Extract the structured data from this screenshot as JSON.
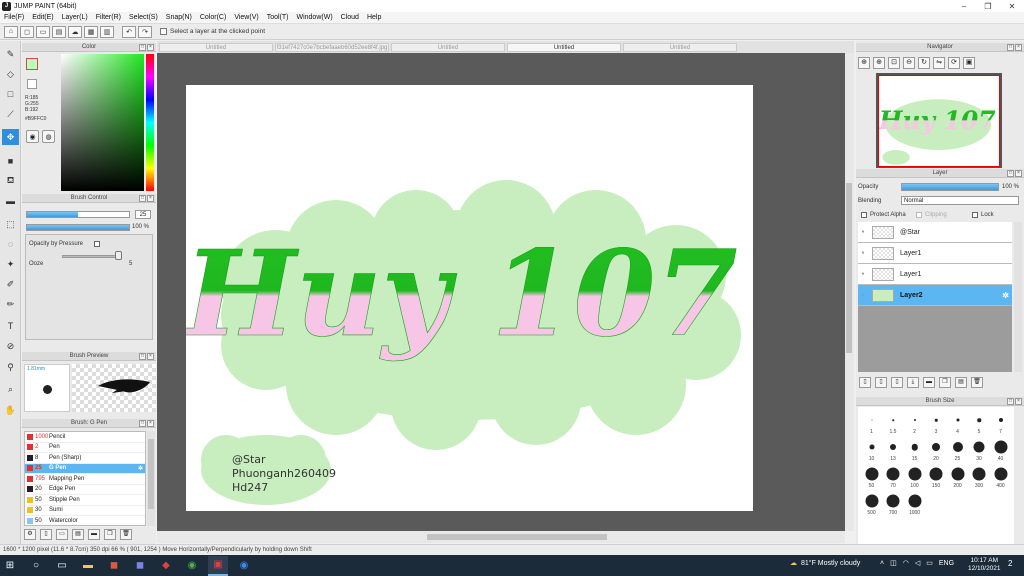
{
  "window": {
    "title": "JUMP PAINT (64bit)",
    "app_icon_glyph": "J",
    "controls": [
      "–",
      "❐",
      "✕"
    ]
  },
  "menu": [
    "File(F)",
    "Edit(E)",
    "Layer(L)",
    "Filter(R)",
    "Select(S)",
    "Snap(N)",
    "Color(C)",
    "View(V)",
    "Tool(T)",
    "Window(W)",
    "Cloud",
    "Help"
  ],
  "toolbar": {
    "hint": "Select a layer at the clicked point"
  },
  "color_panel": {
    "title": "Color",
    "r": "R:185",
    "g": "G:255",
    "b": "B:192",
    "hex": "#B9FFC0",
    "fg_color": "#B9FFC0"
  },
  "brush_control": {
    "title": "Brush Control",
    "size_value": "25",
    "size_fraction": 0.5,
    "opacity_value": "100 %",
    "opacity_fraction": 1.0,
    "opacity_by_pressure": "Opacity by Pressure",
    "ooze_label": "Ooze",
    "ooze_value": "5"
  },
  "brush_preview": {
    "title": "Brush Preview",
    "size": "1.81mm"
  },
  "brush_list": {
    "title": "Brush: G Pen",
    "items": [
      {
        "size": "1000",
        "name": "Pencil",
        "color": "#e03030",
        "size_color": "#e03030"
      },
      {
        "size": "2",
        "name": "Pen",
        "color": "#e03030",
        "size_color": "#e03030"
      },
      {
        "size": "8",
        "name": "Pen (Sharp)",
        "color": "#222222",
        "size_color": "#222222"
      },
      {
        "size": "25",
        "name": "G Pen",
        "color": "#e03030",
        "size_color": "#e03030"
      },
      {
        "size": "795",
        "name": "Mapping Pen",
        "color": "#e03030",
        "size_color": "#e03030"
      },
      {
        "size": "20",
        "name": "Edge Pen",
        "color": "#222222",
        "size_color": "#222222"
      },
      {
        "size": "50",
        "name": "Stipple Pen",
        "color": "#f0c020",
        "size_color": "#222222"
      },
      {
        "size": "30",
        "name": "Sumi",
        "color": "#f0c020",
        "size_color": "#222222"
      },
      {
        "size": "50",
        "name": "Watercolor",
        "color": "#88c8f0",
        "size_color": "#222222"
      }
    ],
    "selected_index": 3
  },
  "tabs": [
    {
      "label": "Untitled",
      "active": false
    },
    {
      "label": "f31ef7427c0e7bcbefaaeb60d52ee8f4f.jpg",
      "active": false
    },
    {
      "label": "Untitled",
      "active": false
    },
    {
      "label": "Untitled",
      "active": true
    },
    {
      "label": "Untitled",
      "active": false
    }
  ],
  "artwork": {
    "main_text": "Huy 107",
    "signature_lines": [
      "@Star",
      "Phuonganh260409",
      "Hd247"
    ]
  },
  "navigator": {
    "title": "Navigator"
  },
  "layer_panel": {
    "title": "Layer",
    "opacity_label": "Opacity",
    "opacity_value": "100 %",
    "blending_label": "Blending",
    "blending_value": "Normal",
    "protect_alpha": "Protect Alpha",
    "clipping": "Clipping",
    "lock": "Lock",
    "layers": [
      {
        "name": "@Star",
        "selected": false
      },
      {
        "name": "Layer1",
        "selected": false
      },
      {
        "name": "Layer1",
        "selected": false
      },
      {
        "name": "Layer2",
        "selected": true
      }
    ]
  },
  "brush_size": {
    "title": "Brush Size",
    "sizes": [
      "1",
      "1.5",
      "2",
      "3",
      "4",
      "5",
      "7",
      "10",
      "13",
      "15",
      "20",
      "25",
      "30",
      "40",
      "50",
      "70",
      "100",
      "150",
      "200",
      "300",
      "400",
      "500",
      "700",
      "1000"
    ]
  },
  "status": {
    "text": "1600 * 1200 pixel  (11.6 * 8.7cm)  350 dpi  66 %  ( 901, 1254 )  Move Horizontally/Perpendicularly by holding down Shift"
  },
  "taskbar": {
    "weather": "81°F  Mostly cloudy",
    "lang": "ENG",
    "time": "10:17 AM",
    "date": "12/10/2021",
    "notifications": "2"
  }
}
